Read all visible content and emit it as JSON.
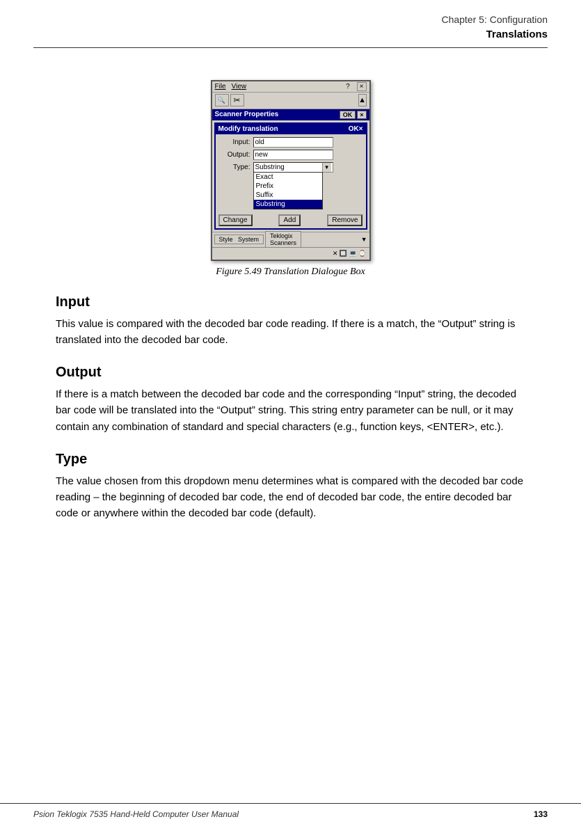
{
  "header": {
    "chapter_line": "Chapter  5:  Configuration",
    "title": "Translations"
  },
  "figure": {
    "caption": "Figure  5.49  Translation  Dialogue  Box",
    "dialog": {
      "menubar": {
        "file": "File",
        "view": "View",
        "help": "?"
      },
      "scanner_properties": {
        "title": "Scanner Properties",
        "ok": "OK",
        "close": "×"
      },
      "modify_translation": {
        "title": "Modify translation",
        "ok": "OK",
        "close": "×",
        "input_label": "Input:",
        "input_value": "old",
        "output_label": "Output:",
        "output_value": "new",
        "type_label": "Type:",
        "type_value": "Substring",
        "dropdown_items": [
          "Exact",
          "Prefix",
          "Suffix",
          "Substring"
        ],
        "selected_item": "Substring"
      },
      "buttons": {
        "change": "Change",
        "add": "Add",
        "remove": "Remove"
      },
      "taskbar": {
        "style": "Style",
        "system": "System",
        "teklogix": "Teklogix",
        "scanners": "Scanners"
      }
    }
  },
  "sections": {
    "input": {
      "heading": "Input",
      "text": "This value is compared with the decoded bar code reading. If there is a match, the “Output” string is translated into the decoded bar code."
    },
    "output": {
      "heading": "Output",
      "text": "If there is a match between the decoded bar code and the corresponding “Input” string, the decoded bar code will be translated into the “Output” string. This string entry parameter can be null, or it may contain any combination of standard and special characters (e.g., function keys, <ENTER>, etc.)."
    },
    "type": {
      "heading": "Type",
      "text": "The value chosen from this dropdown menu determines what is compared with the decoded bar code reading – the beginning of decoded bar code, the end of decoded bar code, the entire decoded bar code or anywhere within the decoded bar code (default)."
    }
  },
  "footer": {
    "left": "Psion Teklogix 7535 Hand-Held Computer User Manual",
    "right": "133"
  }
}
